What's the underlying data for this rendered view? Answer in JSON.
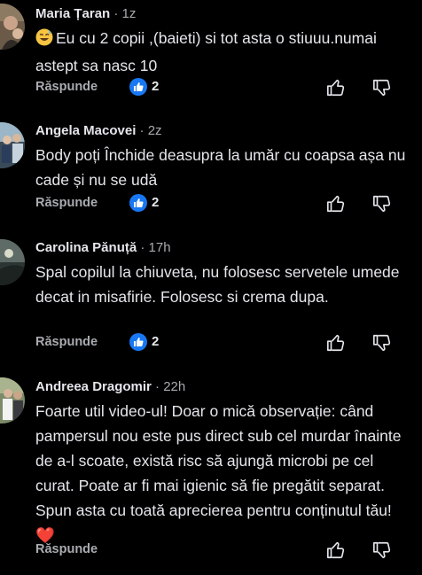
{
  "reply_label": "Răspunde",
  "comments": [
    {
      "author": "Maria Țaran",
      "time": "· 1z",
      "text": "Eu cu 2 copii ,(baieti) si tot asta o stiuuu.numai astept sa nasc 10",
      "emoji": "grinning-sweat-emoji",
      "reactions": "2"
    },
    {
      "author": "Angela Macovei",
      "time": "· 2z",
      "text": "Body poți Închide deasupra la umăr cu coapsa așa nu cade și nu se udă",
      "reactions": "2"
    },
    {
      "author": "Carolina Pănuță",
      "time": "· 17h",
      "text": "Spal copilul la chiuveta, nu folosesc servetele umede decat in misafirie. Folosesc si crema dupa.",
      "reactions": "2"
    },
    {
      "author": "Andreea Dragomir",
      "time": "· 22h",
      "text": "Foarte util video-ul! Doar o mică observație: când pampersul nou este pus direct sub cel murdar înainte de a-l scoate, există risc să ajungă microbi pe cel curat. Poate ar fi mai igienic să fie pregătit separat. Spun asta cu toată aprecierea pentru conținutul tău! ❤️",
      "reactions": ""
    }
  ],
  "colors": {
    "background": "#000000",
    "text": "#e4e6eb",
    "muted": "#a8abaf",
    "like_badge": "#1877f2"
  }
}
